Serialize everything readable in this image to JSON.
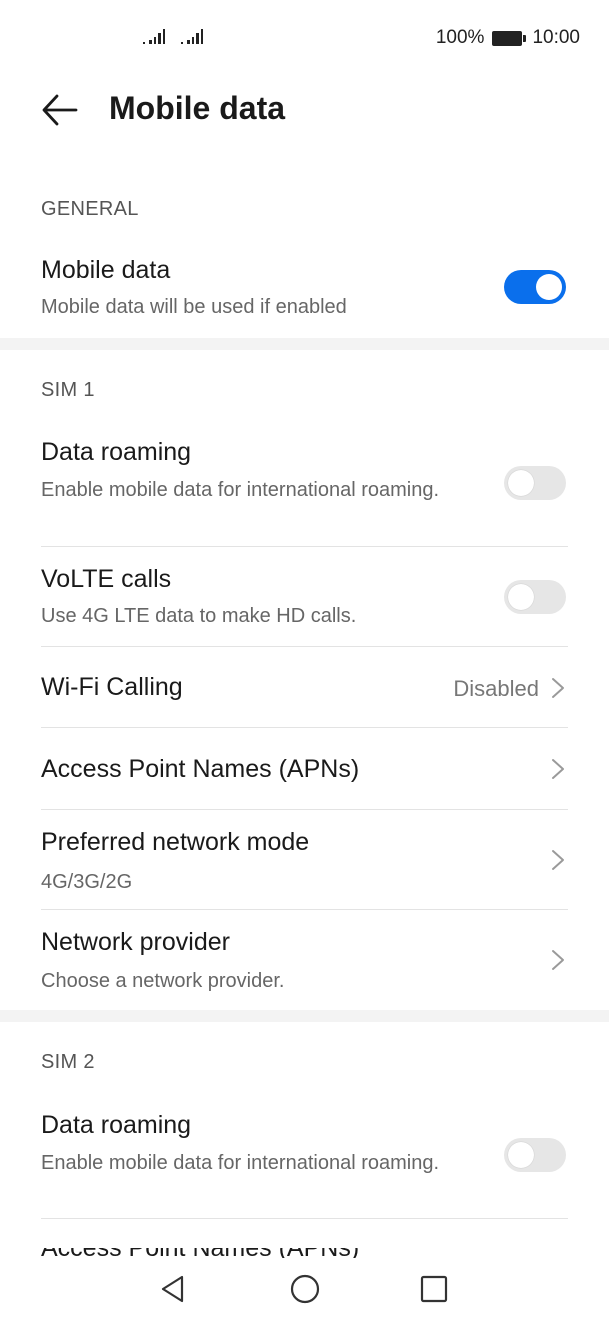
{
  "status_bar": {
    "signal_icons": [
      "signal-icon",
      "signal-icon"
    ],
    "battery_percent": "100%",
    "time": "10:00"
  },
  "header": {
    "title": "Mobile data",
    "back_icon": "arrow-left-icon"
  },
  "general": {
    "label": "GENERAL",
    "mobile_data": {
      "title": "Mobile data",
      "subtitle": "Mobile data will be used if enabled",
      "enabled": true
    }
  },
  "sim1": {
    "label": "SIM 1",
    "data_roaming": {
      "title": "Data roaming",
      "subtitle": "Enable mobile data for international roaming.",
      "enabled": false
    },
    "volte_calls": {
      "title": "VoLTE calls",
      "subtitle": "Use 4G LTE data to make HD calls.",
      "enabled": false
    },
    "wifi_calling": {
      "title": "Wi-Fi Calling",
      "value": "Disabled"
    },
    "apn": {
      "title": "Access Point Names (APNs)"
    },
    "network_mode": {
      "title": "Preferred network mode",
      "subtitle": "4G/3G/2G"
    },
    "network_provider": {
      "title": "Network provider",
      "subtitle": "Choose a network provider."
    }
  },
  "sim2": {
    "label": "SIM 2",
    "data_roaming": {
      "title": "Data roaming",
      "subtitle": "Enable mobile data for international roaming.",
      "enabled": false
    },
    "apn_partial": {
      "title": "Access Point Names (APNs)"
    }
  },
  "nav_bar": {
    "icons": [
      "back-triangle-icon",
      "home-circle-icon",
      "recents-square-icon"
    ]
  },
  "colors": {
    "accent": "#0a6fec",
    "toggle_off": "#e6e6e6",
    "section_band": "#f3f3f3"
  }
}
